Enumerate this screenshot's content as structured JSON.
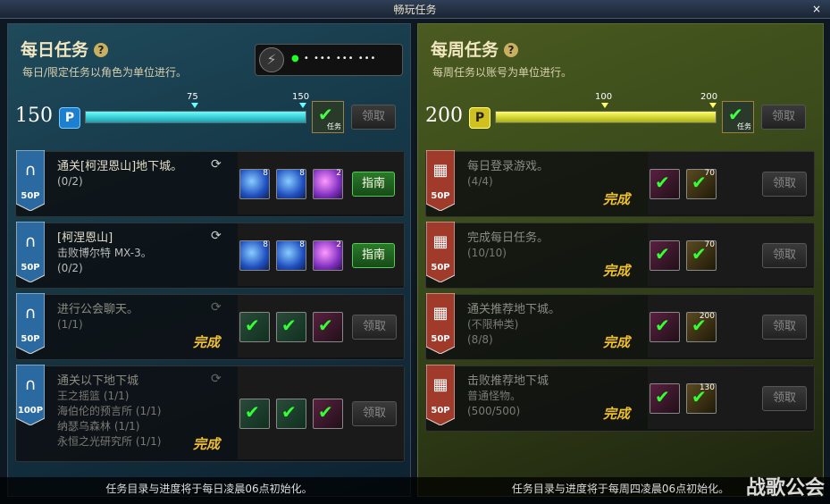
{
  "window": {
    "title": "畅玩任务",
    "close": "×"
  },
  "daily": {
    "title": "每日任务",
    "help": "?",
    "subtitle": "每日/限定任务以角色为单位进行。",
    "fatigue_indicator": "• ••• ••• •••",
    "points": "150",
    "point_icon": "P",
    "progress": {
      "value": 150,
      "max": 150,
      "marks": [
        "75",
        "150"
      ]
    },
    "chest_label": "任务",
    "claim_label": "领取",
    "quests": [
      {
        "points": "50P",
        "name": "通关[柯涅恩山]地下城。",
        "lines": [
          "(0/2)"
        ],
        "guide": "指南",
        "items": [
          {
            "n": "8",
            "c": "blue"
          },
          {
            "n": "8",
            "c": "blue"
          },
          {
            "n": "2",
            "c": "purple"
          }
        ]
      },
      {
        "points": "50P",
        "name": "[柯涅恩山]",
        "lines": [
          "击败博尔特 MX-3。",
          "(0/2)"
        ],
        "guide": "指南",
        "items": [
          {
            "n": "8",
            "c": "blue"
          },
          {
            "n": "8",
            "c": "blue"
          },
          {
            "n": "2",
            "c": "purple"
          }
        ]
      },
      {
        "points": "50P",
        "name": "进行公会聊天。",
        "lines": [
          "(1/1)"
        ],
        "status": "完成",
        "claim": "领取"
      },
      {
        "points": "100P",
        "name": "通关以下地下城",
        "lines": [
          "王之摇篮 (1/1)",
          "海伯伦的预言所 (1/1)",
          "纳瑟乌森林 (1/1)",
          "永恒之光研究所 (1/1)"
        ],
        "status": "完成",
        "claim": "领取"
      }
    ],
    "footer": "任务目录与进度将于每日凌晨06点初始化。"
  },
  "weekly": {
    "title": "每周任务",
    "help": "?",
    "subtitle": "每周任务以账号为单位进行。",
    "points": "200",
    "point_icon": "P",
    "progress": {
      "value": 200,
      "max": 200,
      "marks": [
        "100",
        "200"
      ]
    },
    "chest_label": "任务",
    "claim_label": "领取",
    "quests": [
      {
        "points": "50P",
        "name": "每日登录游戏。",
        "lines": [
          "(4/4)"
        ],
        "status": "完成",
        "claim": "领取",
        "item_num": "70"
      },
      {
        "points": "50P",
        "name": "完成每日任务。",
        "lines": [
          "(10/10)"
        ],
        "status": "完成",
        "claim": "领取",
        "item_num": "70"
      },
      {
        "points": "50P",
        "name": "通关推荐地下城。",
        "lines": [
          "(不限种类)",
          "(8/8)"
        ],
        "status": "完成",
        "claim": "领取",
        "item_num": "200"
      },
      {
        "points": "50P",
        "name": "击败推荐地下城",
        "lines": [
          "普通怪物。",
          "(500/500)"
        ],
        "status": "完成",
        "claim": "领取",
        "item_num": "130"
      }
    ],
    "footer": "任务目录与进度将于每周四凌晨06点初始化。"
  },
  "watermark": "战歌公会",
  "colors": {
    "daily_accent": "#19a0b0",
    "weekly_accent": "#a8b010",
    "complete": "#f0c030"
  }
}
